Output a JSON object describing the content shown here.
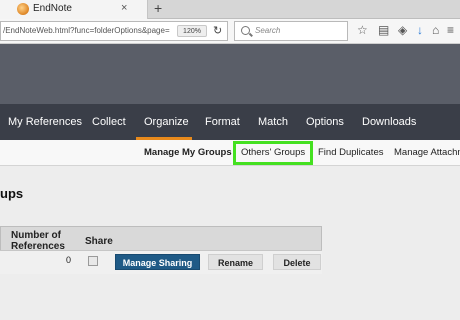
{
  "browser": {
    "tab": {
      "title": "EndNote",
      "close": "×"
    },
    "new_tab": "+",
    "url": "/EndNoteWeb.html?func=folderOptions&page=",
    "zoom": "120%",
    "reload": "↻",
    "search_placeholder": "Search",
    "toolbar_icons": {
      "bookmark_star": "☆",
      "reading_list": "▤",
      "shield": "◈",
      "download": "↓",
      "home": "⌂",
      "menu": "≡"
    }
  },
  "main_nav": {
    "items": [
      "My References",
      "Collect",
      "Organize",
      "Format",
      "Match",
      "Options",
      "Downloads"
    ],
    "active": "Organize",
    "accent_color": "#e88a1c"
  },
  "sub_nav": {
    "items": [
      "Manage My Groups",
      "Others' Groups",
      "Find Duplicates",
      "Manage Attachm"
    ],
    "highlighted": "Others' Groups",
    "highlight_color": "#44e020"
  },
  "page": {
    "title": "ups"
  },
  "table": {
    "headers": {
      "number_of_references": "Number of\nReferences",
      "share": "Share"
    },
    "row": {
      "count": "0",
      "share_checked": false,
      "manage_sharing": "Manage Sharing",
      "rename": "Rename",
      "delete": "Delete"
    }
  }
}
